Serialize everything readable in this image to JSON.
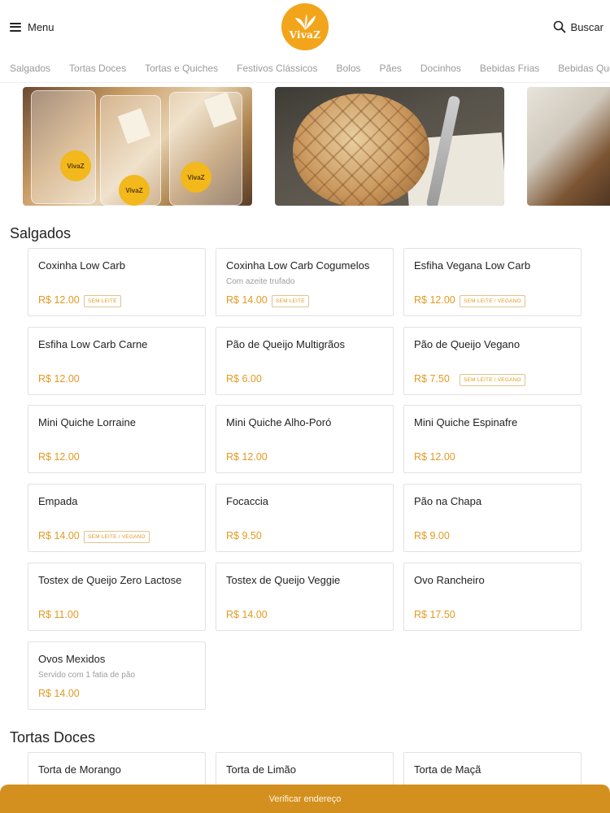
{
  "header": {
    "menu_label": "Menu",
    "logo_text": "VivaZ",
    "search_label": "Buscar",
    "brand_color": "#f2a51a"
  },
  "tabs": [
    "Salgados",
    "Tortas Doces",
    "Tortas e Quiches",
    "Festivos Clássicos",
    "Bolos",
    "Pães",
    "Docinhos",
    "Bebidas Frias",
    "Bebidas Quentes"
  ],
  "banner": {
    "sticker_text": "VivaZ"
  },
  "sections": [
    {
      "title": "Salgados",
      "items": [
        {
          "name": "Coxinha Low Carb",
          "desc": "",
          "price": "R$ 12.00",
          "badge": "SEM LEITE"
        },
        {
          "name": "Coxinha Low Carb Cogumelos",
          "desc": "Com azeite trufado",
          "price": "R$ 14.00",
          "badge": "SEM LEITE"
        },
        {
          "name": "Esfiha Vegana Low Carb",
          "desc": "",
          "price": "R$ 12.00",
          "badge": "SEM LEITE / VEGANO"
        },
        {
          "name": "Esfiha Low Carb Carne",
          "desc": "",
          "price": "R$ 12.00",
          "badge": ""
        },
        {
          "name": "Pão de Queijo Multigrãos",
          "desc": "",
          "price": "R$ 6.00",
          "badge": ""
        },
        {
          "name": "Pão de Queijo Vegano",
          "desc": "",
          "price": "R$ 7.50",
          "badge": "SEM LEITE / VEGANO"
        },
        {
          "name": "Mini Quiche Lorraine",
          "desc": "",
          "price": "R$ 12.00",
          "badge": ""
        },
        {
          "name": "Mini Quiche Alho-Poró",
          "desc": "",
          "price": "R$ 12.00",
          "badge": ""
        },
        {
          "name": "Mini Quiche Espinafre",
          "desc": "",
          "price": "R$ 12.00",
          "badge": ""
        },
        {
          "name": "Empada",
          "desc": "",
          "price": "R$ 14.00",
          "badge": "SEM LEITE / VEGANO"
        },
        {
          "name": "Focaccia",
          "desc": "",
          "price": "R$ 9.50",
          "badge": ""
        },
        {
          "name": "Pão na Chapa",
          "desc": "",
          "price": "R$ 9.00",
          "badge": ""
        },
        {
          "name": "Tostex de Queijo Zero Lactose",
          "desc": "",
          "price": "R$ 11.00",
          "badge": ""
        },
        {
          "name": "Tostex de Queijo Veggie",
          "desc": "",
          "price": "R$ 14.00",
          "badge": ""
        },
        {
          "name": "Ovo Rancheiro",
          "desc": "",
          "price": "R$ 17.50",
          "badge": ""
        },
        {
          "name": "Ovos Mexidos",
          "desc": "Servido com 1 fatia de pão",
          "price": "R$ 14.00",
          "badge": ""
        }
      ]
    },
    {
      "title": "Tortas Doces",
      "items": [
        {
          "name": "Torta de Morango",
          "desc": "",
          "price": "",
          "badge": ""
        },
        {
          "name": "Torta de Limão",
          "desc": "",
          "price": "",
          "badge": ""
        },
        {
          "name": "Torta de Maçã",
          "desc": "",
          "price": "",
          "badge": ""
        }
      ]
    }
  ],
  "bottom_bar": {
    "label": "Verificar endereço",
    "color": "#d4901e"
  }
}
